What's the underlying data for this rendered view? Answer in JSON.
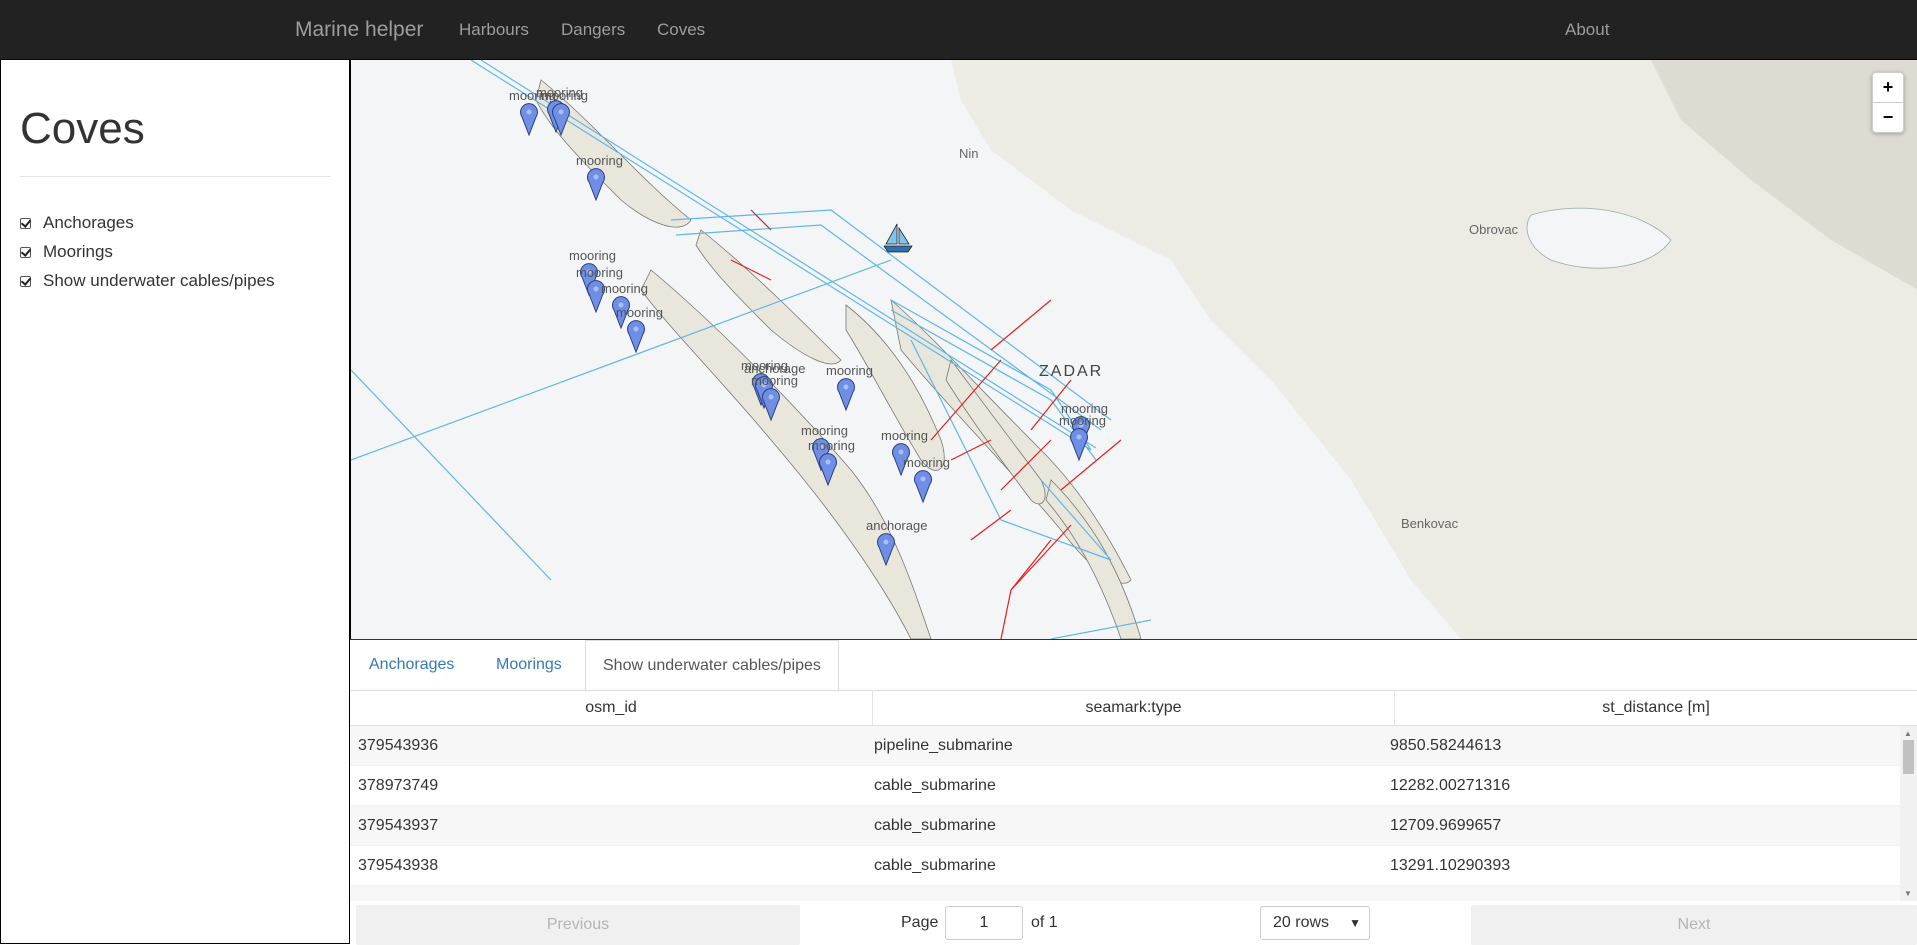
{
  "navbar": {
    "brand": "Marine helper",
    "links": [
      "Harbours",
      "Dangers",
      "Coves"
    ],
    "about": "About"
  },
  "sidebar": {
    "title": "Coves",
    "options": [
      {
        "label": "Anchorages",
        "checked": true
      },
      {
        "label": "Moorings",
        "checked": true
      },
      {
        "label": "Show underwater cables/pipes",
        "checked": true
      }
    ]
  },
  "map": {
    "zoom_in": "+",
    "zoom_out": "−",
    "place_labels": [
      "Nin",
      "ZADAR",
      "Obrovac",
      "Benkovac"
    ],
    "marker_labels": [
      "mooring",
      "mooring",
      "mooring",
      "mooring",
      "mooring",
      "mooring",
      "mooring",
      "mooring",
      "mooring",
      "anchorage",
      "mooring",
      "mooring",
      "mooring",
      "mooring",
      "mooring",
      "mooring",
      "mooring",
      "mooring",
      "anchorage"
    ],
    "colors": {
      "marker": "#6f8fe6",
      "cable": "#5fb7e6",
      "pipeline": "#e02020"
    }
  },
  "panel": {
    "tabs": [
      "Anchorages",
      "Moorings",
      "Show underwater cables/pipes"
    ],
    "active_tab": "Show underwater cables/pipes",
    "columns": [
      "osm_id",
      "seamark:type",
      "st_distance [m]"
    ],
    "rows": [
      {
        "osm_id": "379543936",
        "type": "pipeline_submarine",
        "distance": "9850.58244613"
      },
      {
        "osm_id": "378973749",
        "type": "cable_submarine",
        "distance": "12282.00271316"
      },
      {
        "osm_id": "379543937",
        "type": "cable_submarine",
        "distance": "12709.9699657"
      },
      {
        "osm_id": "379543938",
        "type": "cable_submarine",
        "distance": "13291.10290393"
      }
    ],
    "pager": {
      "previous": "Previous",
      "page_label": "Page",
      "page_value": "1",
      "of_label": "of 1",
      "rows_option": "20 rows",
      "next": "Next"
    }
  }
}
